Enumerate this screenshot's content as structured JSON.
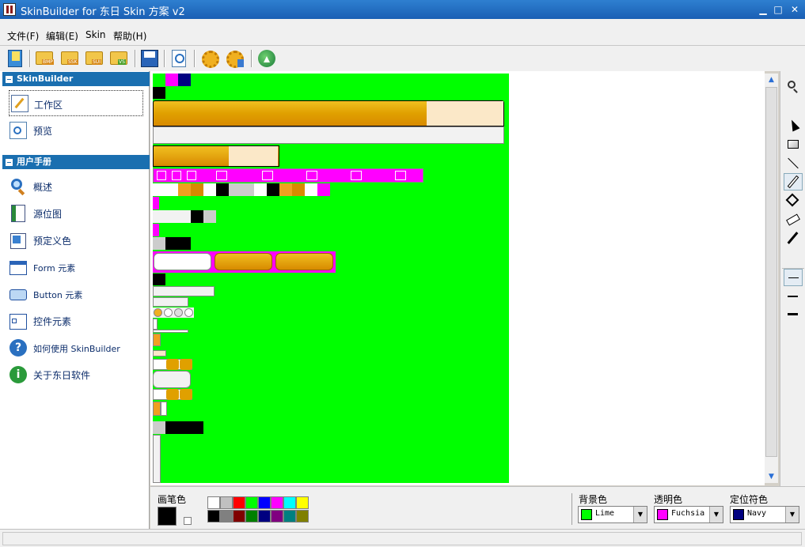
{
  "window": {
    "title": "SkinBuilder for 东日 Skin 方案 v2",
    "minimize": "▁",
    "maximize": "□",
    "close": "✕"
  },
  "menu": [
    "文件(F)",
    "编辑(E)",
    "Skin",
    "帮助(H)"
  ],
  "toolbar": {
    "buttons": [
      {
        "name": "new-icon",
        "badge": ""
      },
      {
        "name": "open-bmp-icon",
        "badge": "BMP"
      },
      {
        "name": "open-ssk-icon",
        "badge": "SSK"
      },
      {
        "name": "open-sui-icon",
        "badge": "SUI"
      },
      {
        "name": "open-vs-icon",
        "badge": "VS"
      },
      {
        "name": "save-icon",
        "badge": ""
      },
      {
        "name": "preview-icon",
        "badge": ""
      },
      {
        "name": "settings-gear-icon",
        "badge": ""
      },
      {
        "name": "settings-gear-2-icon",
        "badge": ""
      },
      {
        "name": "update-globe-icon",
        "badge": ""
      }
    ]
  },
  "sidebar": {
    "section1": {
      "title": "SkinBuilder",
      "items": [
        {
          "label": "工作区",
          "icon": "workspace-icon"
        },
        {
          "label": "预览",
          "icon": "preview-icon"
        }
      ]
    },
    "section2": {
      "title": "用户手册",
      "items": [
        {
          "label": "概述",
          "icon": "overview-search-icon"
        },
        {
          "label": "源位图",
          "icon": "source-bitmap-icon"
        },
        {
          "label": "预定义色",
          "icon": "predefined-color-icon"
        },
        {
          "label": "Form 元素",
          "icon": "form-element-icon"
        },
        {
          "label": "Button 元素",
          "icon": "button-element-icon"
        },
        {
          "label": "控件元素",
          "icon": "control-element-icon"
        },
        {
          "label": "如何使用 SkinBuilder",
          "icon": "howto-help-icon"
        },
        {
          "label": "关于东日软件",
          "icon": "about-info-icon"
        }
      ]
    }
  },
  "tools": [
    "zoom-icon",
    "pointer-icon",
    "rectangle-icon",
    "line-icon",
    "pencil-icon",
    "fill-bucket-icon",
    "eraser-icon",
    "eyedropper-icon"
  ],
  "line_widths": [
    "1",
    "2",
    "3"
  ],
  "color_panel": {
    "pen_label": "画笔色",
    "palette": [
      "#ffffff",
      "#c0c0c0",
      "#ff0000",
      "#00ff00",
      "#0000ff",
      "#ff00ff",
      "#00ffff",
      "#ffff00",
      "#000000",
      "#808080",
      "#800000",
      "#008000",
      "#000080",
      "#800080",
      "#008080",
      "#808000"
    ],
    "background": {
      "label": "背景色",
      "value": "Lime",
      "color": "#00ff00"
    },
    "transparent": {
      "label": "透明色",
      "value": "Fuchsia",
      "color": "#ff00ff"
    },
    "locator": {
      "label": "定位符色",
      "value": "Navy",
      "color": "#000080"
    }
  },
  "colors": {
    "title_bar": "#1a5fb4",
    "section_header": "#1a6fb0",
    "canvas_bg": "#00ff00",
    "gold": "#e0a000",
    "transparent": "#ff00ff"
  }
}
